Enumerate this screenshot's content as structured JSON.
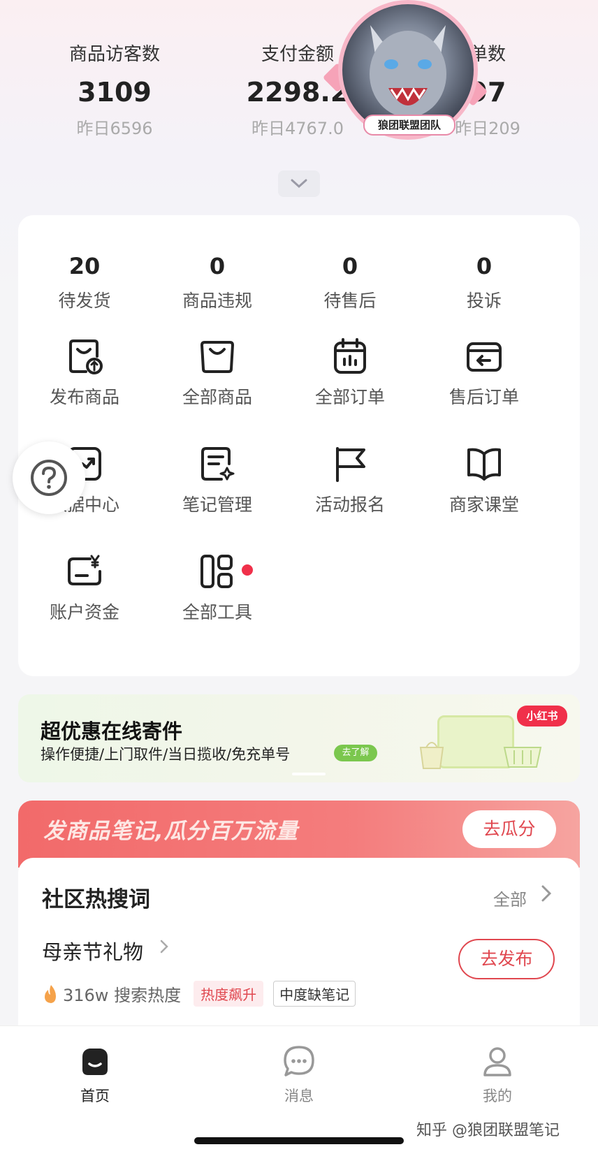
{
  "stats": [
    {
      "label": "商品访客数",
      "value": "3109",
      "prev": "昨日6596"
    },
    {
      "label": "支付金额",
      "value": "2298.2",
      "prev": "昨日4767.0"
    },
    {
      "label": "单数",
      "value": "97",
      "prev": "昨日209"
    }
  ],
  "overlay_tag": "狼团联盟团队",
  "counters": [
    {
      "value": "20",
      "label": "待发货"
    },
    {
      "value": "0",
      "label": "商品违规"
    },
    {
      "value": "0",
      "label": "待售后"
    },
    {
      "value": "0",
      "label": "投诉"
    }
  ],
  "tools": [
    {
      "label": "发布商品",
      "icon": "publish-product-icon"
    },
    {
      "label": "全部商品",
      "icon": "shopping-bag-icon"
    },
    {
      "label": "全部订单",
      "icon": "orders-calendar-icon"
    },
    {
      "label": "售后订单",
      "icon": "after-sales-icon"
    },
    {
      "label": "数据中心",
      "icon": "trend-chart-icon"
    },
    {
      "label": "笔记管理",
      "icon": "note-edit-icon"
    },
    {
      "label": "活动报名",
      "icon": "flag-icon"
    },
    {
      "label": "商家课堂",
      "icon": "book-icon"
    },
    {
      "label": "账户资金",
      "icon": "wallet-yen-icon"
    },
    {
      "label": "全部工具",
      "icon": "all-tools-icon"
    }
  ],
  "banner": {
    "title": "超优惠在线寄件",
    "subtitle": "操作便捷/上门取件/当日揽收/免充单号",
    "cta": "去了解",
    "brand": "小红书"
  },
  "promo": {
    "text": "发商品笔记,瓜分百万流量",
    "button": "去瓜分"
  },
  "hot_search": {
    "title": "社区热搜词",
    "all_label": "全部",
    "keyword": "母亲节礼物",
    "heat": "316w 搜索热度",
    "tag_rising": "热度飙升",
    "tag_gap": "中度缺笔记",
    "publish": "去发布"
  },
  "tabbar": [
    {
      "label": "首页",
      "active": true,
      "icon": "home-icon"
    },
    {
      "label": "消息",
      "active": false,
      "icon": "message-icon"
    },
    {
      "label": "我的",
      "active": false,
      "icon": "profile-icon"
    }
  ],
  "watermark": "知乎 @狼团联盟笔记",
  "colors": {
    "accent": "#e0474f",
    "badge": "#f0304a",
    "text": "#222222",
    "muted": "#aaaaaa"
  }
}
